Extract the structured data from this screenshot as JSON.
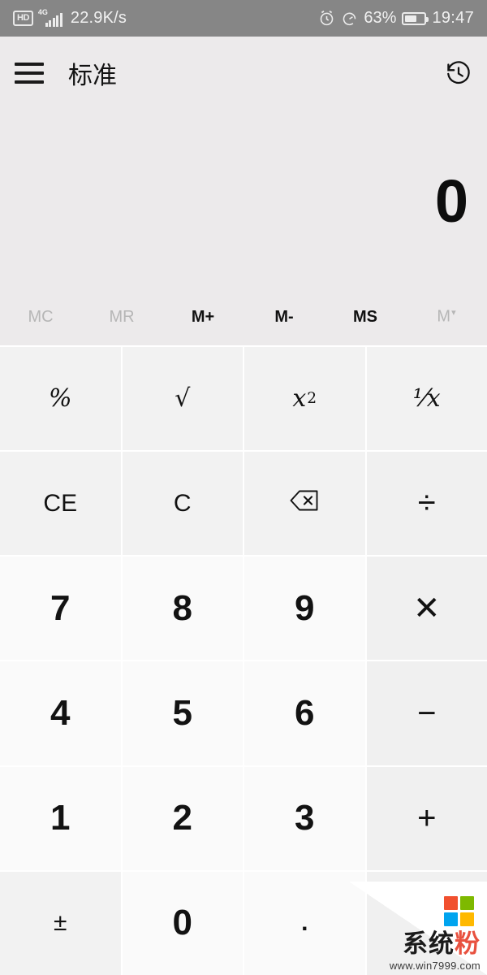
{
  "status_bar": {
    "hd_label": "HD",
    "network_type": "4G",
    "signal_bars": 5,
    "data_speed": "22.9K/s",
    "alarm_icon": "alarm-clock-icon",
    "data_saver_icon": "data-saver-icon",
    "battery_percent": "63%",
    "battery_level": 63,
    "time": "19:47",
    "background": "#868686",
    "foreground": "#f1f1f1"
  },
  "app_bar": {
    "menu_icon": "hamburger-menu-icon",
    "title": "标准",
    "history_icon": "history-icon"
  },
  "display": {
    "value": "0"
  },
  "memory_row": [
    {
      "label": "MC",
      "name": "memory-clear",
      "enabled": false
    },
    {
      "label": "MR",
      "name": "memory-recall",
      "enabled": false
    },
    {
      "label": "M+",
      "name": "memory-add",
      "enabled": true
    },
    {
      "label": "M-",
      "name": "memory-subtract",
      "enabled": true
    },
    {
      "label": "MS",
      "name": "memory-store",
      "enabled": true
    },
    {
      "label": "M",
      "name": "memory-dropdown",
      "enabled": false,
      "chevron": "▾"
    }
  ],
  "keypad": {
    "rows": [
      [
        {
          "label": "%",
          "name": "percent-key",
          "type": "math"
        },
        {
          "label": "√",
          "name": "square-root-key",
          "type": "math-upright"
        },
        {
          "label": "x",
          "sup": "2",
          "name": "square-key",
          "type": "math"
        },
        {
          "label": "⅟x",
          "name": "reciprocal-key",
          "type": "math"
        }
      ],
      [
        {
          "label": "CE",
          "name": "clear-entry-key",
          "type": "fn"
        },
        {
          "label": "C",
          "name": "clear-key",
          "type": "fn"
        },
        {
          "label": "⌫",
          "name": "backspace-key",
          "type": "icon"
        },
        {
          "label": "÷",
          "name": "divide-key",
          "type": "op"
        }
      ],
      [
        {
          "label": "7",
          "name": "digit-7-key",
          "type": "num"
        },
        {
          "label": "8",
          "name": "digit-8-key",
          "type": "num"
        },
        {
          "label": "9",
          "name": "digit-9-key",
          "type": "num"
        },
        {
          "label": "✕",
          "name": "multiply-key",
          "type": "op"
        }
      ],
      [
        {
          "label": "4",
          "name": "digit-4-key",
          "type": "num"
        },
        {
          "label": "5",
          "name": "digit-5-key",
          "type": "num"
        },
        {
          "label": "6",
          "name": "digit-6-key",
          "type": "num"
        },
        {
          "label": "−",
          "name": "subtract-key",
          "type": "op"
        }
      ],
      [
        {
          "label": "1",
          "name": "digit-1-key",
          "type": "num"
        },
        {
          "label": "2",
          "name": "digit-2-key",
          "type": "num"
        },
        {
          "label": "3",
          "name": "digit-3-key",
          "type": "num"
        },
        {
          "label": "+",
          "name": "add-key",
          "type": "op"
        }
      ],
      [
        {
          "label": "±",
          "name": "sign-toggle-key",
          "type": "fn"
        },
        {
          "label": "0",
          "name": "digit-0-key",
          "type": "num"
        },
        {
          "label": ".",
          "name": "decimal-point-key",
          "type": "num-dot"
        },
        {
          "label": "=",
          "name": "equals-key",
          "type": "op"
        }
      ]
    ]
  },
  "watermark": {
    "brand": "系统",
    "brand_accent": "粉",
    "url": "www.win7999.com",
    "logo_colors": [
      "#f1502f",
      "#7eb900",
      "#00a4ef",
      "#ffb900"
    ]
  },
  "colors": {
    "page_bg": "#eceaeb",
    "key_bg": "#f2f2f2",
    "num_key_bg": "#fafafa",
    "op_key_bg": "#f0f0f0",
    "text": "#121212",
    "muted": "#b6b6b6"
  }
}
